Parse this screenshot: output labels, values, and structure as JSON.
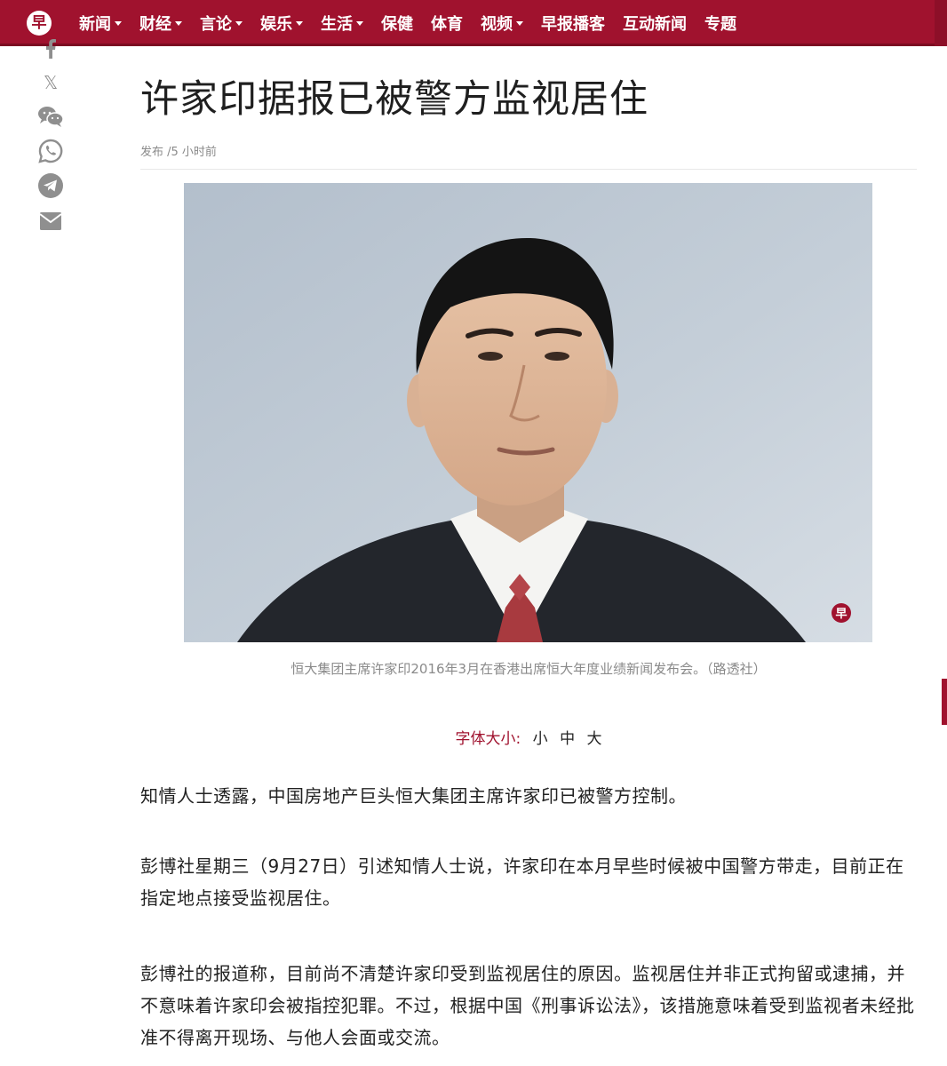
{
  "nav": {
    "logo_text": "早",
    "items": [
      {
        "label": "新闻",
        "dropdown": true
      },
      {
        "label": "财经",
        "dropdown": true
      },
      {
        "label": "言论",
        "dropdown": true
      },
      {
        "label": "娱乐",
        "dropdown": true
      },
      {
        "label": "生活",
        "dropdown": true
      },
      {
        "label": "保健",
        "dropdown": false
      },
      {
        "label": "体育",
        "dropdown": false
      },
      {
        "label": "视频",
        "dropdown": true
      },
      {
        "label": "早报播客",
        "dropdown": false
      },
      {
        "label": "互动新闻",
        "dropdown": false
      },
      {
        "label": "专题",
        "dropdown": false
      }
    ],
    "brand_color": "#a0122e"
  },
  "share": {
    "icons": [
      "facebook-icon",
      "x-icon",
      "wechat-icon",
      "whatsapp-icon",
      "telegram-icon",
      "email-icon"
    ],
    "x_label": "𝕏"
  },
  "article": {
    "title": "许家印据报已被警方监视居住",
    "meta": "发布 /5 小时前",
    "photo_watermark": "早",
    "caption": "恒大集团主席许家印2016年3月在香港出席恒大年度业绩新闻发布会。（路透社）",
    "font_size": {
      "label": "字体大小:",
      "options": [
        "小",
        "中",
        "大"
      ]
    },
    "paragraphs": [
      "知情人士透露，中国房地产巨头恒大集团主席许家印已被警方控制。",
      "彭博社星期三（9月27日）引述知情人士说，许家印在本月早些时候被中国警方带走，目前正在指定地点接受监视居住。",
      "彭博社的报道称，目前尚不清楚许家印受到监视居住的原因。监视居住并非正式拘留或逮捕，并不意味着许家印会被指控犯罪。不过，根据中国《刑事诉讼法》，该措施意味着受到监视者未经批准不得离开现场、与他人会面或交流。"
    ]
  }
}
